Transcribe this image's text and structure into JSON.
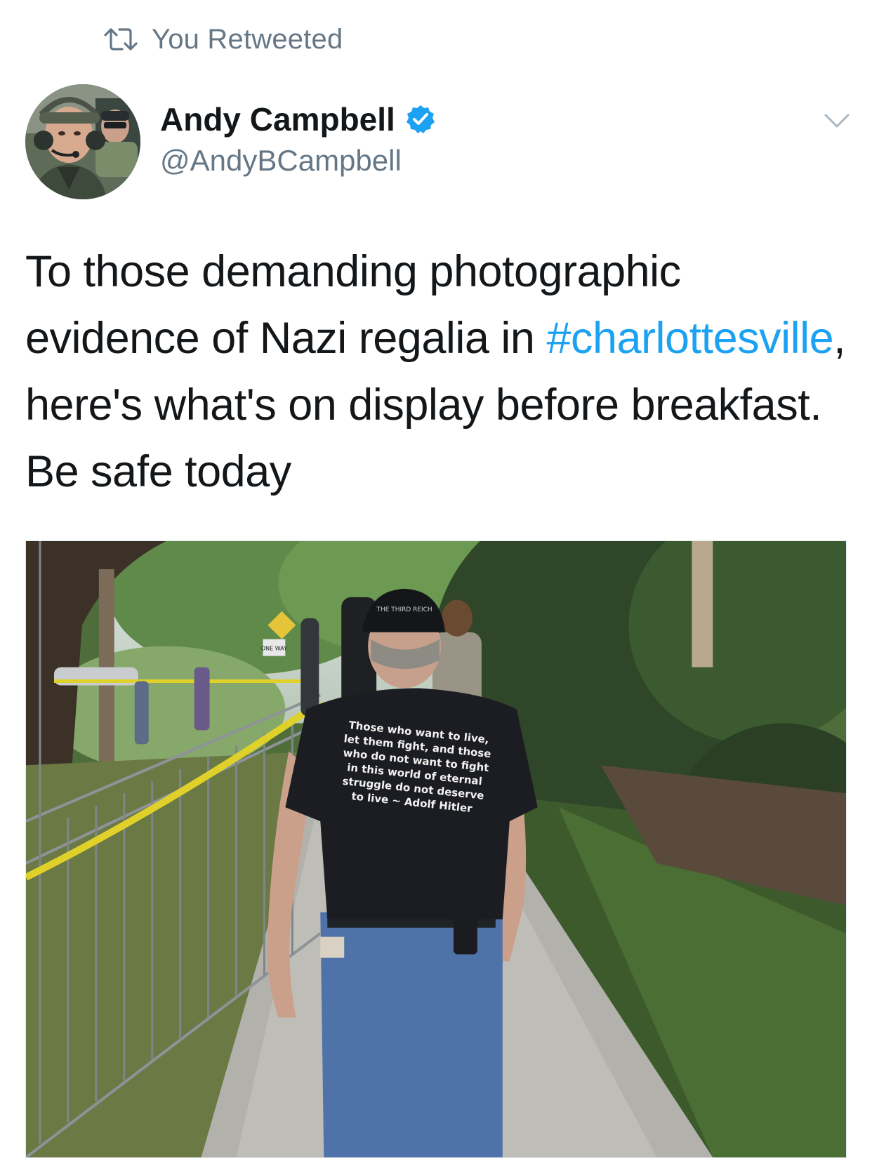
{
  "retweet": {
    "icon": "retweet-icon",
    "label": "You Retweeted"
  },
  "author": {
    "name": "Andy Campbell",
    "handle": "@AndyBCampbell",
    "verified_icon": "verified-badge-icon",
    "avatar_icon": "profile-avatar"
  },
  "menu": {
    "icon": "chevron-down-icon"
  },
  "tweet": {
    "text_before": "To those demanding photographic evidence of Nazi regalia in ",
    "hashtag": "#charlottesville",
    "text_after": ", here's what's on display before breakfast. Be safe today"
  },
  "photo": {
    "shirt_lines": [
      "Those who want to live,",
      "let them fight, and those",
      "who do not want to fight",
      "in this world of eternal",
      "struggle do not deserve",
      "to live ~ Adolf Hitler"
    ],
    "hat_text": "THE THIRD REICH",
    "sign_text": "ONE WAY"
  },
  "colors": {
    "link": "#1da1f2",
    "secondary_text": "#657786",
    "primary_text": "#14171a",
    "verified": "#1da1f2"
  }
}
